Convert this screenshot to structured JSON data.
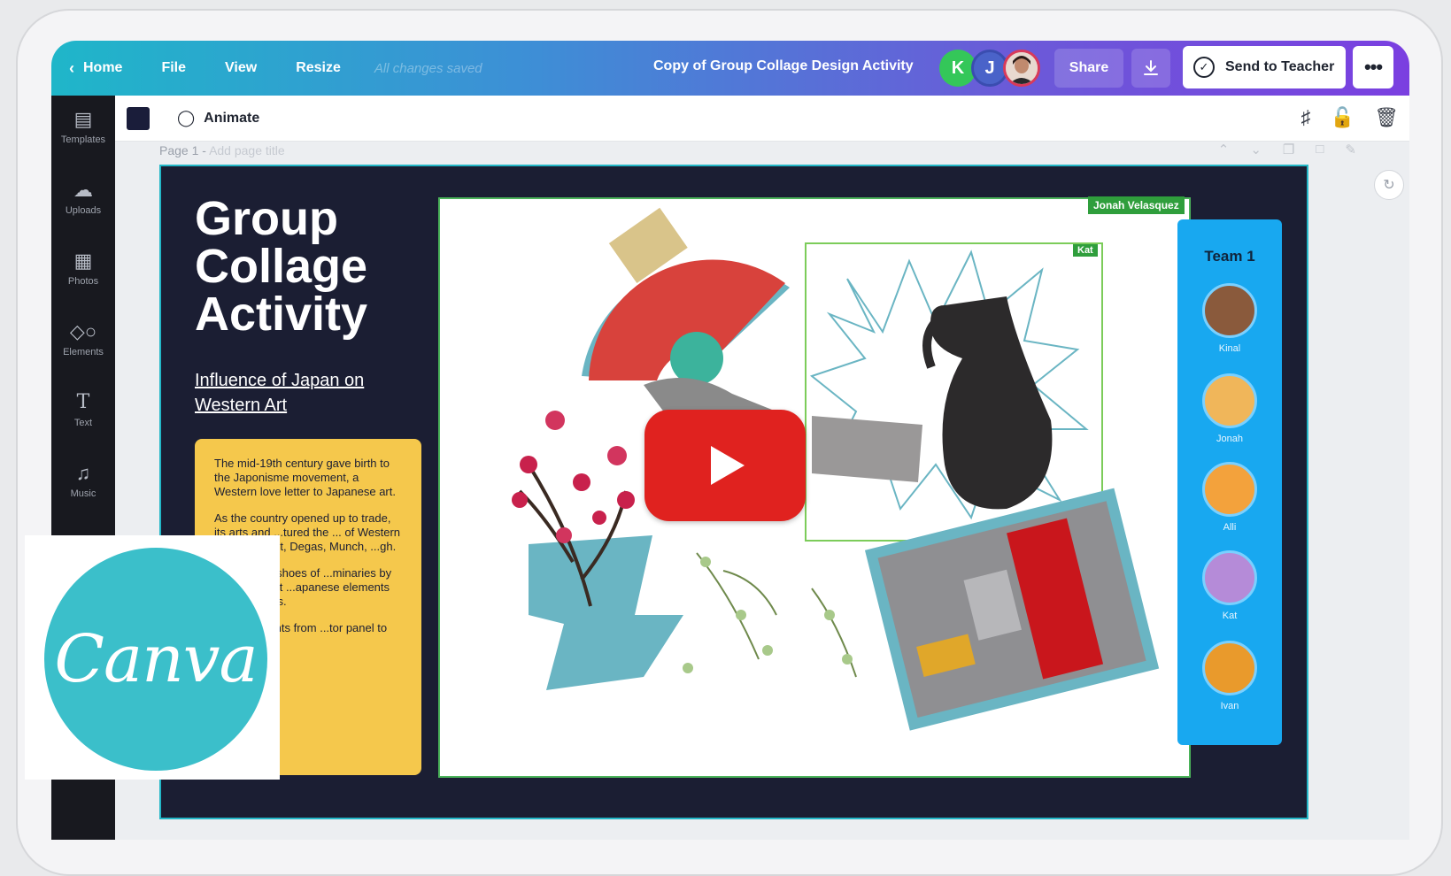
{
  "topbar": {
    "home": "Home",
    "file": "File",
    "view": "View",
    "resize": "Resize",
    "status": "All changes saved",
    "doc_title": "Copy of Group Collage Design Activity",
    "avatars": [
      "K",
      "J"
    ],
    "share": "Share",
    "send": "Send to Teacher",
    "more": "•••"
  },
  "sidebar": {
    "items": [
      {
        "label": "Templates",
        "icon": "templates-icon"
      },
      {
        "label": "Uploads",
        "icon": "uploads-icon"
      },
      {
        "label": "Photos",
        "icon": "photos-icon"
      },
      {
        "label": "Elements",
        "icon": "elements-icon"
      },
      {
        "label": "Text",
        "icon": "text-icon"
      },
      {
        "label": "Music",
        "icon": "music-icon"
      }
    ]
  },
  "toolbar": {
    "animate": "Animate"
  },
  "page": {
    "label": "Page 1 -",
    "title_placeholder": "Add page title"
  },
  "design": {
    "title": "Group Collage Activity",
    "subtitle": "Influence of Japan on Western Art",
    "card_p1": "The mid-19th century gave birth to the Japonisme movement, a Western love letter to Japanese art.",
    "card_p2": "As the country opened up to trade, its arts and ...tured the ... of Western artists, ...anet, Degas, Munch, ...gh.",
    "card_p3": "...ves in the shoes of ...minaries by ...collage that ...apanese elements ...rn concepts.",
    "card_p4": "...rop elements from ...tor panel to create",
    "chip_jonah": "Jonah Velasquez",
    "chip_kat": "Kat"
  },
  "team": {
    "title": "Team 1",
    "members": [
      "Kinal",
      "Jonah",
      "Alli",
      "Kat",
      "Ivan"
    ]
  },
  "logo": {
    "text": "Canva",
    "color": "#3bbfca"
  },
  "colors": {
    "brand_gradient_start": "#1fb6c9",
    "brand_gradient_end": "#7a3fe0",
    "youtube_red": "#e0221f"
  }
}
